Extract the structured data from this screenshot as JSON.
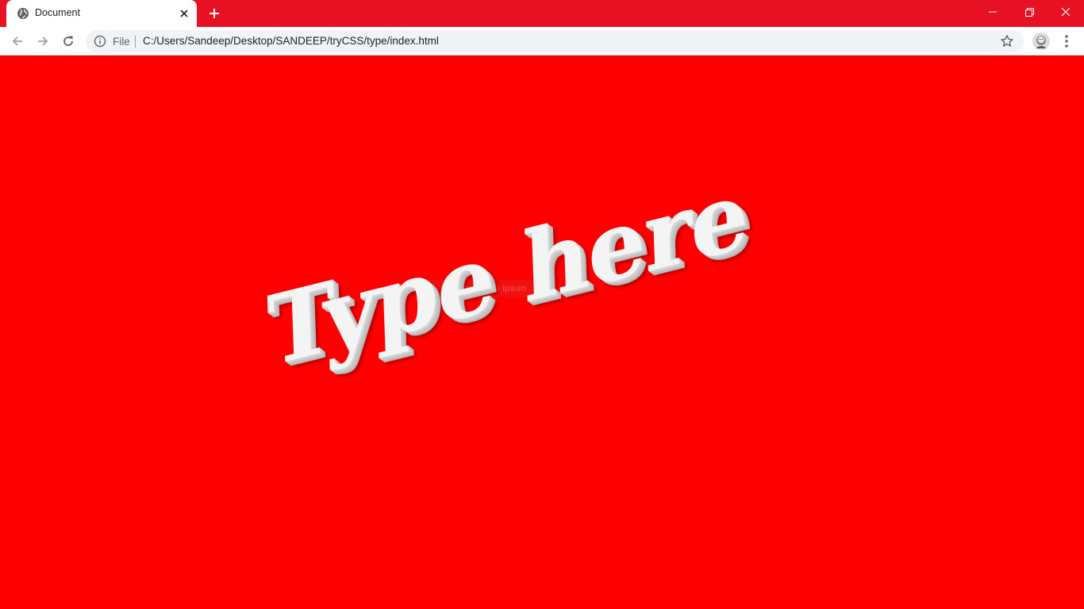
{
  "browser": {
    "tab": {
      "title": "Document",
      "favicon": "globe-icon"
    },
    "toolbar": {
      "security_label": "File",
      "url": "C:/Users/Sandeep/Desktop/SANDEEP/tryCSS/type/index.html"
    },
    "colors": {
      "titlebar": "#e81123",
      "page_background": "#ff0000"
    }
  },
  "page": {
    "input": {
      "placeholder": "Enter Lorem Ipsum"
    },
    "display_text": "Type here"
  }
}
